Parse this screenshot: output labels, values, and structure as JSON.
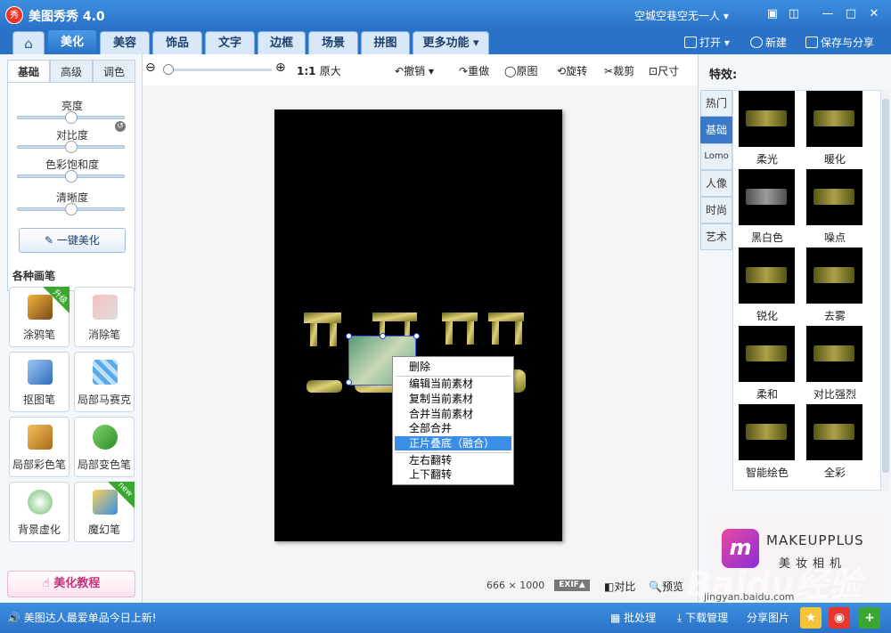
{
  "app": {
    "title": "美图秀秀 4.0",
    "logo": "秀",
    "user": "空城空巷空无一人"
  },
  "window_controls": [
    "message-icon",
    "skin-icon",
    "minimize-icon",
    "maximize-icon",
    "close-icon"
  ],
  "menu": {
    "tabs": [
      "美化",
      "美容",
      "饰品",
      "文字",
      "边框",
      "场景",
      "拼图",
      "更多功能"
    ],
    "active": "美化",
    "open_label": "打开",
    "new_label": "新建",
    "save_label": "保存与分享"
  },
  "left": {
    "subtabs": [
      "基础",
      "高级",
      "调色"
    ],
    "sliders": [
      {
        "label": "亮度",
        "value": 0.5
      },
      {
        "label": "对比度",
        "value": 0.5
      },
      {
        "label": "色彩饱和度",
        "value": 0.5
      },
      {
        "label": "清晰度",
        "value": 0.5
      }
    ],
    "onekey": "一键美化",
    "brush_header": "各种画笔",
    "brushes": [
      {
        "label": "涂鸦笔",
        "badge": "升级"
      },
      {
        "label": "消除笔",
        "badge": ""
      },
      {
        "label": "抠图笔",
        "badge": ""
      },
      {
        "label": "局部马赛克",
        "badge": ""
      },
      {
        "label": "局部彩色笔",
        "badge": ""
      },
      {
        "label": "局部变色笔",
        "badge": ""
      },
      {
        "label": "背景虚化",
        "badge": ""
      },
      {
        "label": "魔幻笔",
        "badge": "new"
      }
    ],
    "tutorial": "美化教程"
  },
  "toolbar": {
    "zoom_ratio": "1:1",
    "original_size": "原大",
    "undo": "撤销",
    "redo": "重做",
    "original": "原图",
    "rotate": "旋转",
    "crop": "裁剪",
    "resize": "尺寸"
  },
  "context_menu": {
    "items": [
      "删除",
      "编辑当前素材",
      "复制当前素材",
      "合并当前素材",
      "全部合并",
      "正片叠底（融合）",
      "左右翻转",
      "上下翻转"
    ],
    "highlighted": "正片叠底（融合）"
  },
  "image_info": {
    "width": "666",
    "times": "×",
    "height": "1000",
    "exif": "EXIF▲",
    "compare": "对比",
    "preview": "预览"
  },
  "right": {
    "title": "特效:",
    "categories": [
      "热门",
      "基础",
      "Lomo",
      "人像",
      "时尚",
      "艺术"
    ],
    "active_category": "基础",
    "effects": [
      "柔光",
      "暖化",
      "黑白色",
      "噪点",
      "锐化",
      "去雾",
      "柔和",
      "对比强烈",
      "智能绘色",
      "全彩"
    ],
    "ad": {
      "logo": "m",
      "title": "MAKEUPPLUS",
      "subtitle": "美妆相机"
    }
  },
  "status": {
    "message": "美图达人最爱单品今日上新!",
    "batch": "批处理",
    "download": "下载管理",
    "share": "分享图片"
  },
  "watermark": {
    "text": "Baidu经验",
    "url": "jingyan.baidu.com"
  },
  "colors": {
    "brand_blue": "#2a72c8",
    "highlight": "#3a8ee6",
    "green": "#3aa830"
  }
}
